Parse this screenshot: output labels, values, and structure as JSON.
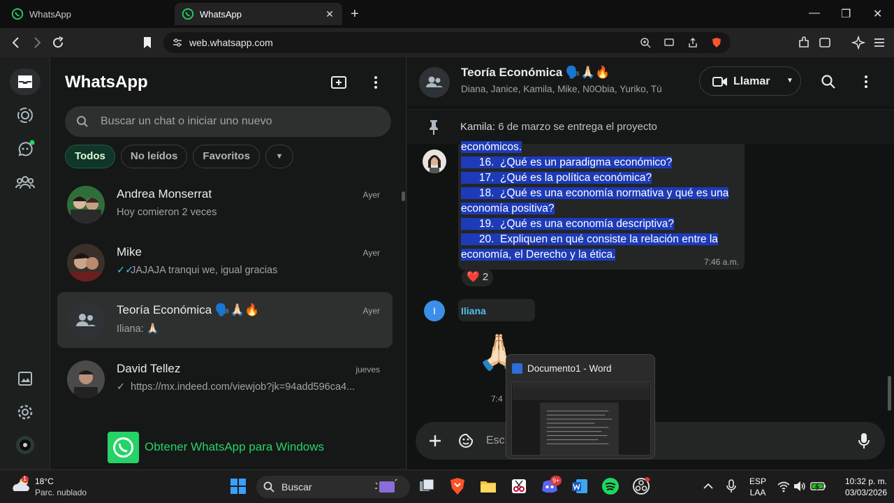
{
  "browser": {
    "tabs": [
      {
        "title": "WhatsApp",
        "active": false
      },
      {
        "title": "WhatsApp",
        "active": true
      }
    ],
    "url": "web.whatsapp.com"
  },
  "whatsapp": {
    "title": "WhatsApp",
    "search_placeholder": "Buscar un chat o iniciar uno nuevo",
    "filters": [
      "Todos",
      "No leídos",
      "Favoritos"
    ],
    "active_filter": "Todos",
    "chats": [
      {
        "name": "Andrea Monserrat",
        "time": "Ayer",
        "preview": "Hoy comieron 2 veces",
        "ticks": ""
      },
      {
        "name": "Mike",
        "time": "Ayer",
        "preview": "JAJAJA tranqui we, igual gracias",
        "ticks": "✓✓"
      },
      {
        "name": "Teoría Económica 🗣️🙏🏻🔥",
        "time": "Ayer",
        "preview": "Iliana: 🙏🏻",
        "ticks": ""
      },
      {
        "name": "David Tellez",
        "time": "jueves",
        "preview": "https://mx.indeed.com/viewjob?jk=94add596ca4...",
        "ticks": "✓"
      }
    ],
    "get_app": "Obtener WhatsApp para Windows"
  },
  "conversation": {
    "group_name": "Teoría Económica 🗣️🙏🏻🔥",
    "members": "Diana, Janice, Kamila, Mike, N0Obia, Yuriko, Tú",
    "call_label": "Llamar",
    "pinned_sender": "Kamila:",
    "pinned_text": " 6 de marzo se entrega el proyecto",
    "message_lines": [
      "económicos.",
      "      16.  ¿Qué es un paradigma económico?",
      "      17.  ¿Qué es la política económica?",
      "      18.  ¿Qué es una economía normativa y qué es una",
      "economía positiva?",
      "      19.  ¿Qué es una economía descriptiva?",
      "      20.  Expliquen en qué consiste la relación entre la",
      "economía, el Derecho y la ética."
    ],
    "message_time": "7:46 a.m.",
    "reaction": "❤️",
    "reaction_count": "2",
    "sender2": "Iliana",
    "sender2_initial": "I",
    "sticker": "🙏🏻",
    "time2": "7:4",
    "composer_placeholder": "Esc"
  },
  "preview": {
    "title": "Documento1 - Word"
  },
  "taskbar": {
    "weather_temp": "18°C",
    "weather_desc": "Parc. nublado",
    "weather_badge": "1",
    "search_label": "Buscar",
    "discord_badge": "9+",
    "lang_line1": "ESP",
    "lang_line2": "LAA",
    "time": "10:32 p. m.",
    "date": "03/03/2026"
  }
}
